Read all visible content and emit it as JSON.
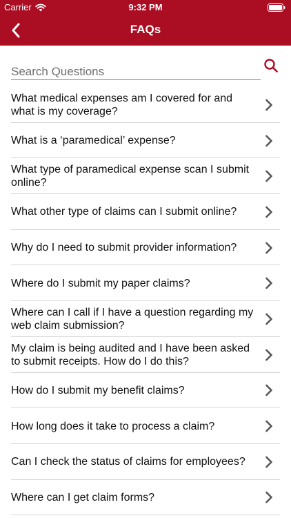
{
  "status_bar": {
    "carrier": "Carrier",
    "time": "9:32 PM"
  },
  "nav": {
    "title": "FAQs",
    "back_icon": "chevron-left-icon"
  },
  "search": {
    "placeholder": "Search Questions",
    "value": "",
    "icon": "search-icon"
  },
  "colors": {
    "accent": "#ab0d23",
    "chevron": "#555555",
    "divider": "#d6d6d6"
  },
  "faqs": [
    {
      "question": "What medical expenses am I covered for and what is my coverage?"
    },
    {
      "question": "What is a ‘paramedical’ expense?"
    },
    {
      "question": "What type of paramedical expense scan I submit online?"
    },
    {
      "question": "What other type of claims can I submit online?"
    },
    {
      "question": "Why do I need to submit provider information?"
    },
    {
      "question": "Where do I submit my paper claims?"
    },
    {
      "question": "Where can I call if I have a question regarding my web claim submission?"
    },
    {
      "question": "My claim is being audited and I have been asked to submit receipts. How do I do this?"
    },
    {
      "question": "How do I submit my benefit claims?"
    },
    {
      "question": "How long does it take to process a claim?"
    },
    {
      "question": "Can I check the status of claims for employees?"
    },
    {
      "question": "Where can I get claim forms?"
    }
  ]
}
